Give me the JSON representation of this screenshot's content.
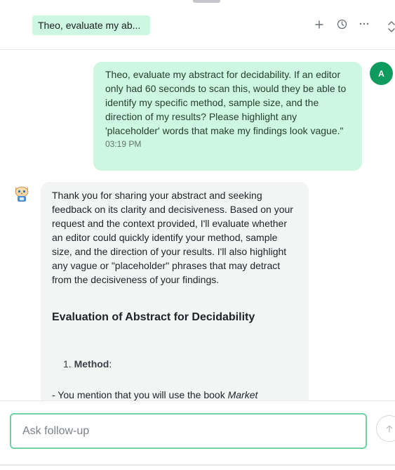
{
  "header": {
    "title": "Theo, evaluate my ab...",
    "icons": [
      "plus-icon",
      "history-icon",
      "more-icon",
      "expand-icon"
    ]
  },
  "user_message": {
    "avatar_initial": "A",
    "text": "Theo, evaluate my abstract for decidability. If an editor only had 60 seconds to scan this, would they be able to identify my specific method, sample size, and the direction of my results? Please highlight any 'placeholder' words that make my findings look vague.\"",
    "time": "03:19 PM"
  },
  "bot_message": {
    "avatar_icon": "cat-bot-icon",
    "intro": "Thank you for sharing your abstract and seeking feedback on its clarity and decisiveness. Based on your request and the context provided, I'll evaluate whether an editor could quickly identify your method, sample size, and the direction of your results. I'll also highlight any vague or \"placeholder\" phrases that may detract from the decisiveness of your findings.",
    "heading": "Evaluation of Abstract for Decidability",
    "list_number": "1.",
    "list_item_label": "Method",
    "list_item_suffix": ":",
    "dash_text": "- You mention that you will use the book ",
    "dash_italic": "Market"
  },
  "composer": {
    "placeholder": "Ask follow-up",
    "send_icon": "arrow-up-icon"
  }
}
